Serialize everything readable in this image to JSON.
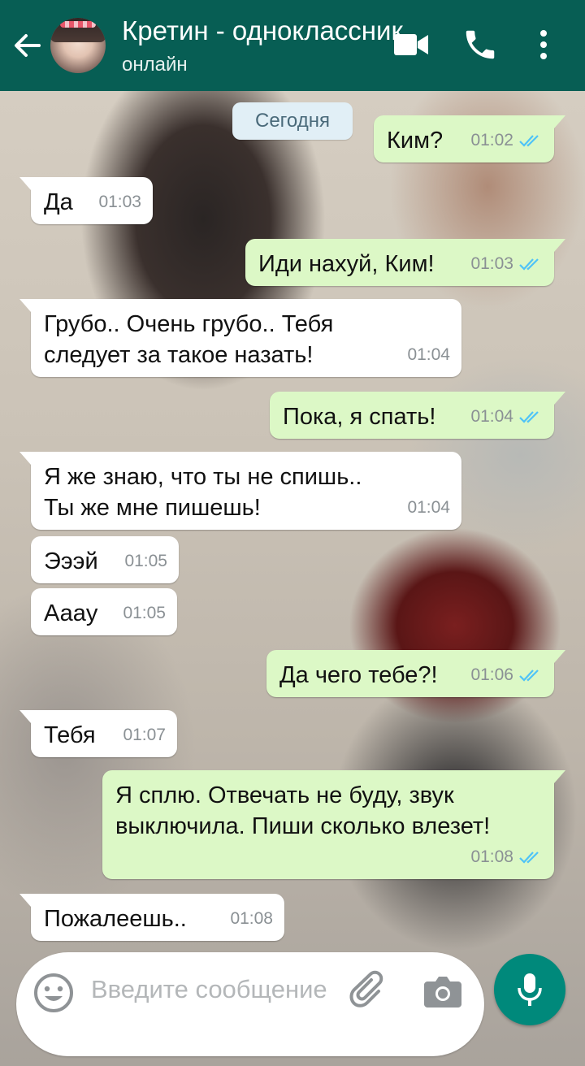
{
  "header": {
    "contact_name": "Кретин - одноклассник",
    "status": "онлайн",
    "background": "#075e54"
  },
  "icons": {
    "back": "arrow-left-icon",
    "video": "video-camera-icon",
    "call": "phone-icon",
    "menu": "more-vert-icon",
    "emoji": "emoji-icon",
    "attach": "paperclip-icon",
    "camera": "camera-icon",
    "mic": "microphone-icon",
    "read": "double-check-icon"
  },
  "chat": {
    "date_label": "Сегодня",
    "messages": [
      {
        "dir": "out",
        "text": "Ким?",
        "time": "01:02",
        "read": true
      },
      {
        "dir": "in",
        "text": "Да",
        "time": "01:03"
      },
      {
        "dir": "out",
        "text": "Иди нахуй, Ким!",
        "time": "01:03",
        "read": true
      },
      {
        "dir": "in",
        "text": "Грубо.. Очень грубо.. Тебя следует за такое назать!",
        "time": "01:04"
      },
      {
        "dir": "out",
        "text": "Пока, я спать!",
        "time": "01:04",
        "read": true
      },
      {
        "dir": "in",
        "text": "Я же знаю, что ты не спишь.. Ты же мне пишешь!",
        "time": "01:04"
      },
      {
        "dir": "in",
        "text": "Эээй",
        "time": "01:05"
      },
      {
        "dir": "in",
        "text": "Аааy",
        "time": "01:05"
      },
      {
        "dir": "out",
        "text": "Да чего тебе?!",
        "time": "01:06",
        "read": true
      },
      {
        "dir": "in",
        "text": "Тебя",
        "time": "01:07"
      },
      {
        "dir": "out",
        "text": "Я сплю. Отвечать не буду, звук выключила. Пиши сколько влезет!",
        "time": "01:08",
        "read": true
      },
      {
        "dir": "in",
        "text": "Пожалеешь..",
        "time": "01:08"
      }
    ],
    "incoming_color": "#ffffff",
    "outgoing_color": "#dcf8c6",
    "tick_color": "#4fc3f7"
  },
  "composer": {
    "placeholder": "Введите сообщение",
    "mic_color": "#00897b"
  }
}
